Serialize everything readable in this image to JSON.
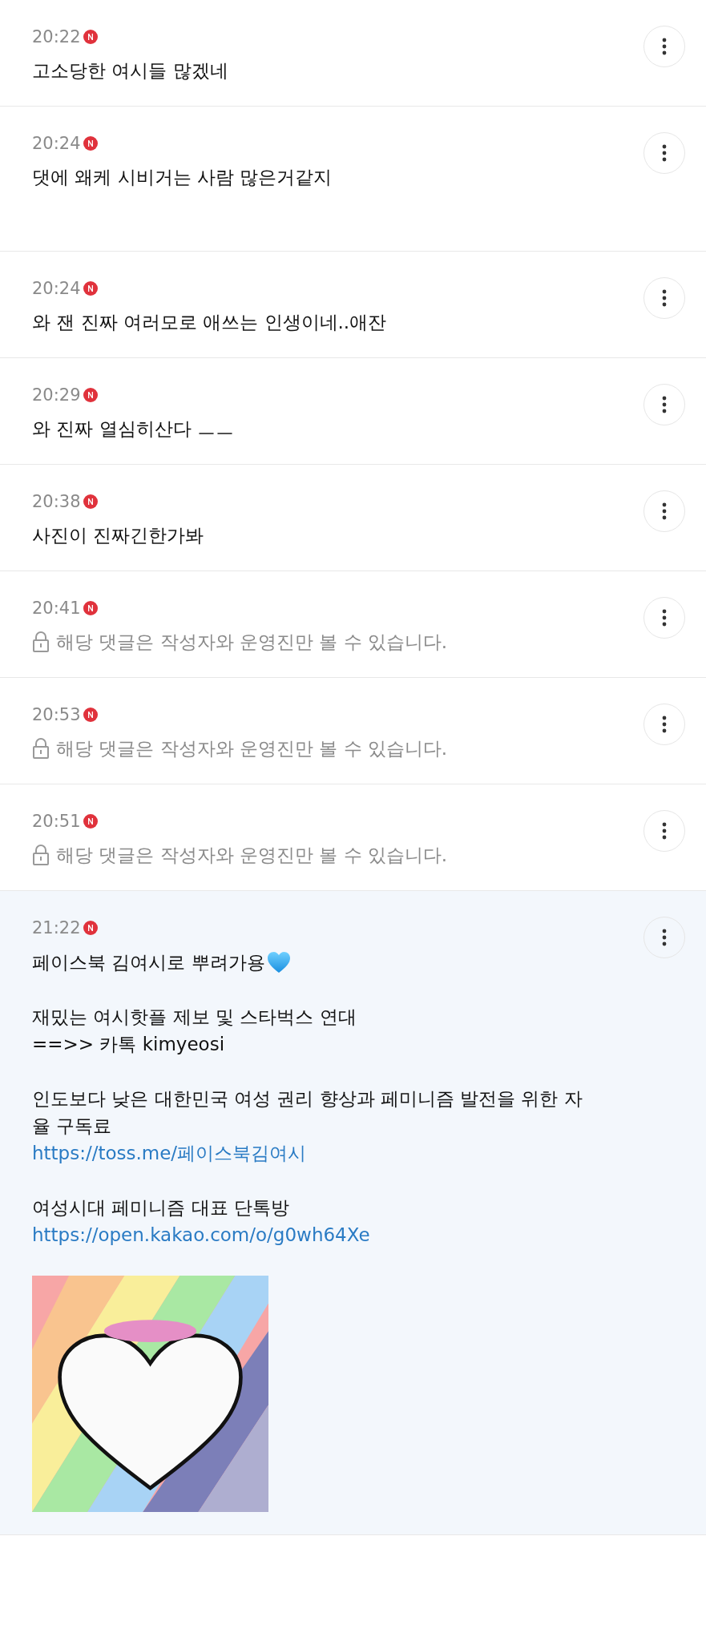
{
  "comments": [
    {
      "time": "20:22",
      "is_new": true,
      "kind": "comment",
      "highlighted": false,
      "tall": false,
      "text": "고소당한 여시들 많겠네"
    },
    {
      "time": "20:24",
      "is_new": true,
      "kind": "comment",
      "highlighted": false,
      "tall": true,
      "text": "댓에 왜케 시비거는 사람 많은거같지"
    },
    {
      "time": "20:24",
      "is_new": true,
      "kind": "comment",
      "highlighted": false,
      "tall": false,
      "text": "와 잰 진짜 여러모로 애쓰는 인생이네..애잔"
    },
    {
      "time": "20:29",
      "is_new": true,
      "kind": "comment",
      "highlighted": false,
      "tall": false,
      "text": "와 진짜 열심히산다 ㅡㅡ"
    },
    {
      "time": "20:38",
      "is_new": true,
      "kind": "comment",
      "highlighted": false,
      "tall": false,
      "text": "사진이 진짜긴한가봐"
    },
    {
      "time": "20:41",
      "is_new": true,
      "kind": "private",
      "highlighted": false,
      "tall": false,
      "text": "해당 댓글은 작성자와 운영진만 볼 수 있습니다."
    },
    {
      "time": "20:53",
      "is_new": true,
      "kind": "private",
      "highlighted": false,
      "tall": false,
      "text": "해당 댓글은 작성자와 운영진만 볼 수 있습니다."
    },
    {
      "time": "20:51",
      "is_new": true,
      "kind": "private",
      "highlighted": false,
      "tall": false,
      "text": "해당 댓글은 작성자와 운영진만 볼 수 있습니다."
    },
    {
      "time": "21:22",
      "is_new": true,
      "kind": "post",
      "highlighted": true,
      "tall": false,
      "paragraphs": [
        [
          {
            "kind": "text_heart",
            "text": "페이스북 김여시로 뿌려가용"
          }
        ],
        [
          {
            "kind": "text",
            "text": "재밌는 여시핫플 제보 및 스타벅스 연대"
          },
          {
            "kind": "text",
            "text": "==>> 카톡 kimyeosi"
          }
        ],
        [
          {
            "kind": "text",
            "text": "인도보다 낮은 대한민국 여성 권리 향상과 페미니즘 발전을 위한 자율 구독료"
          },
          {
            "kind": "link",
            "text": "https://toss.me/페이스북김여시"
          }
        ],
        [
          {
            "kind": "text",
            "text": "여성시대 페미니즘 대표 단톡방"
          },
          {
            "kind": "link",
            "text": "https://open.kakao.com/o/g0wh64Xe"
          }
        ],
        [
          {
            "kind": "picture"
          }
        ]
      ]
    }
  ]
}
